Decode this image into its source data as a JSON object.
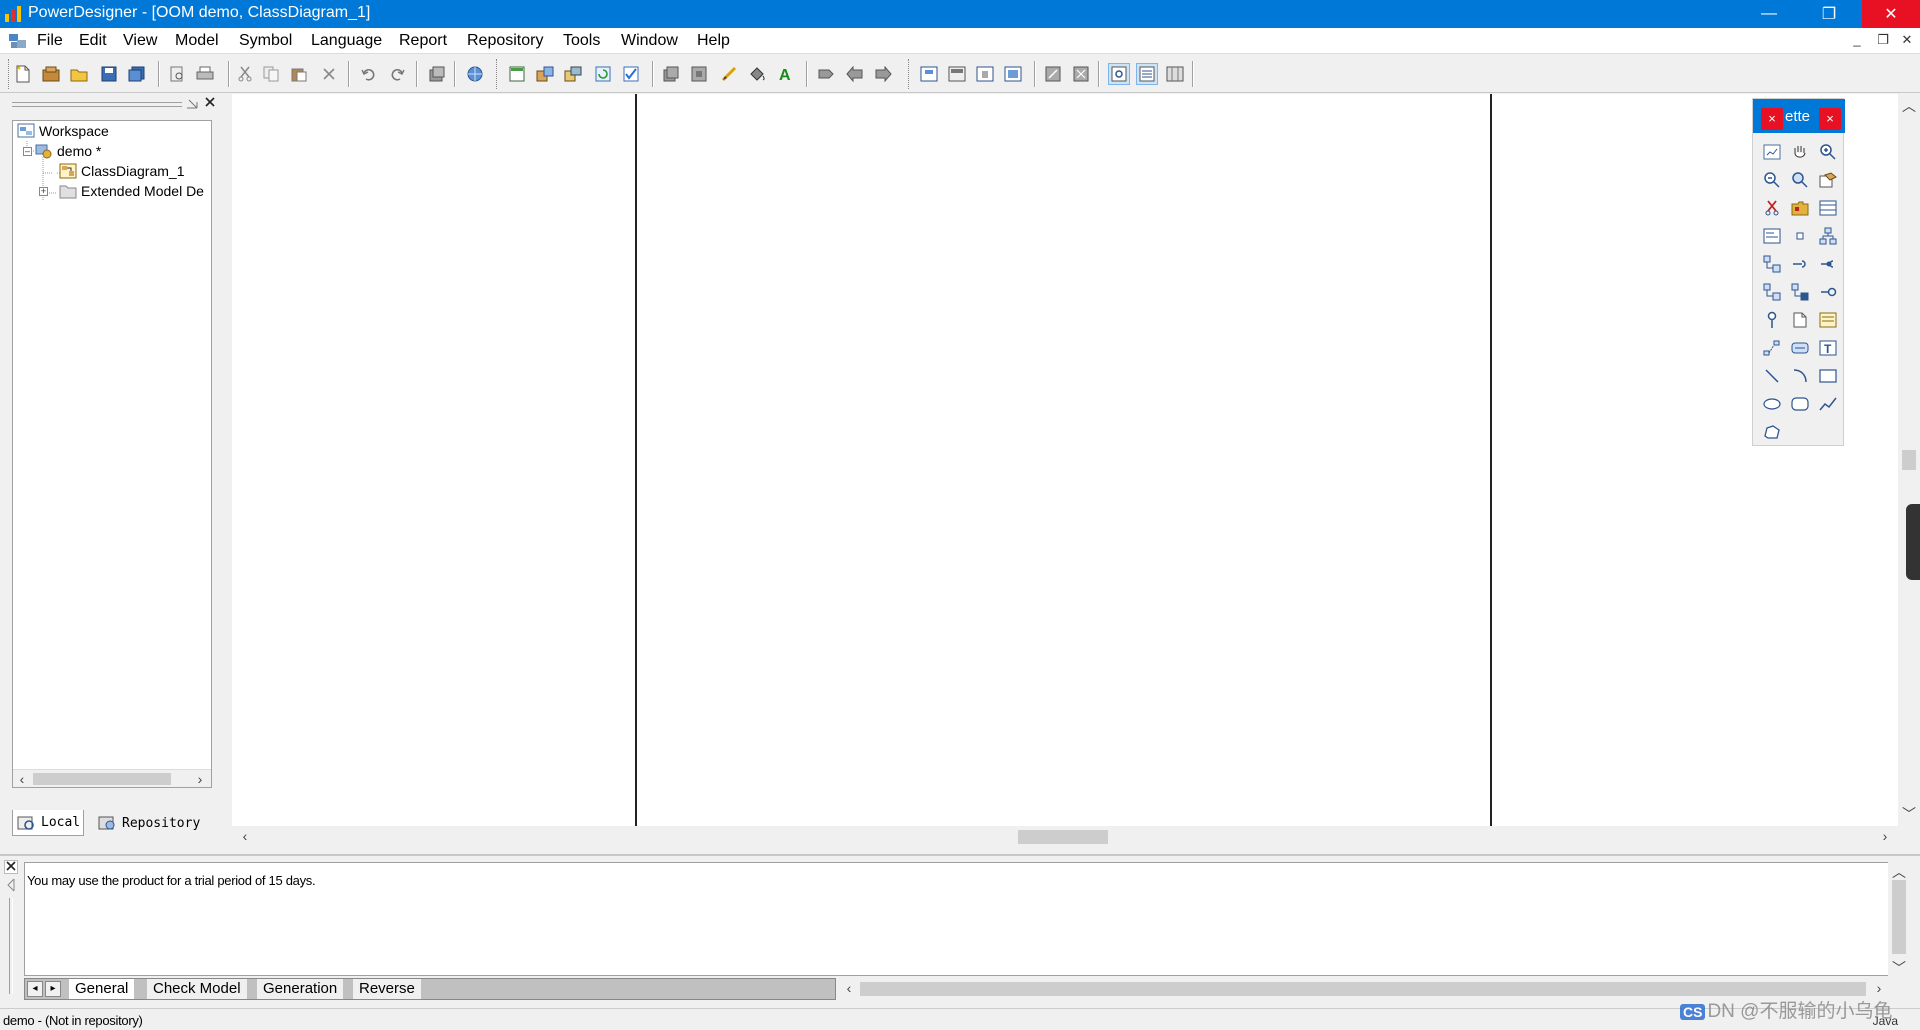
{
  "window": {
    "title": "PowerDesigner - [OOM demo, ClassDiagram_1]",
    "minimize": "—",
    "restore": "❐",
    "close": "✕"
  },
  "menu": {
    "items": [
      "File",
      "Edit",
      "View",
      "Model",
      "Symbol",
      "Language",
      "Report",
      "Repository",
      "Tools",
      "Window",
      "Help"
    ],
    "mdi_controls": [
      "_",
      "❐",
      "✕"
    ]
  },
  "browser": {
    "tree": {
      "workspace": "Workspace",
      "model": "demo *",
      "diagram": "ClassDiagram_1",
      "extensions": "Extended Model De"
    },
    "tabs": {
      "local": "Local",
      "repository": "Repository"
    }
  },
  "palette": {
    "title": "ette",
    "close_label": "×"
  },
  "output": {
    "message": "You may use the product for a trial period of 15 days.",
    "tabs": [
      "General",
      "Check Model",
      "Generation",
      "Reverse"
    ]
  },
  "status": {
    "text": "demo - (Not in repository)",
    "language": "Java"
  },
  "watermark": {
    "badge": "CS",
    "text": "DN @不服输的小乌龟"
  },
  "colors": {
    "titlebar": "#0078d7",
    "close": "#e81123",
    "canvas": "#ffffff"
  }
}
